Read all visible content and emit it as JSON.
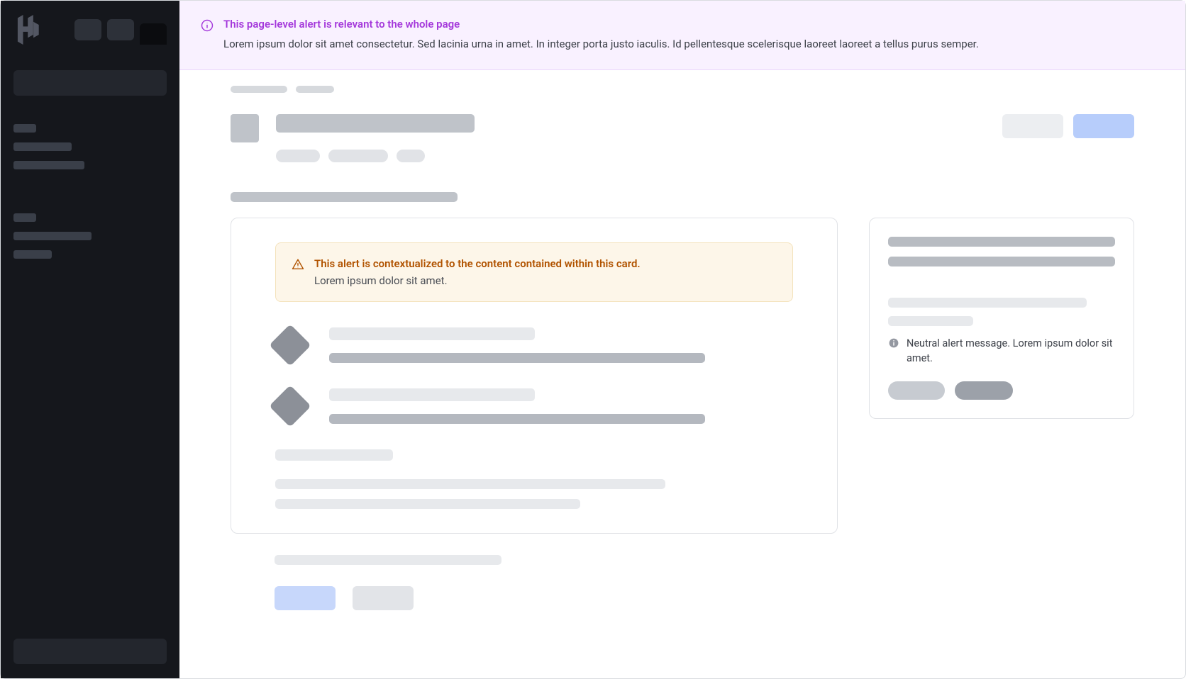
{
  "pageAlert": {
    "title": "This page-level alert is relevant to the whole page",
    "body": "Lorem ipsum dolor sit amet consectetur. Sed lacinia urna in amet. In integer porta justo iaculis. Id pellentesque scelerisque laoreet laoreet a tellus purus semper."
  },
  "cardAlert": {
    "title": "This alert is contextualized to the content contained within this card.",
    "body": "Lorem ipsum dolor sit amet."
  },
  "compactAlert": {
    "text": "Neutral alert message. Lorem ipsum dolor sit amet."
  }
}
